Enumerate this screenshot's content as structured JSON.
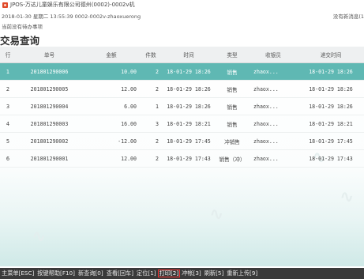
{
  "window": {
    "title": "JPOS-万达儿童娱乐有限公司德州(0002)-0002v机"
  },
  "info": {
    "status_line": "2018-01-30 星期二 13:55:39 0002-0002v-zhaoxuerong",
    "right_text": "没有新消息(1",
    "todo": "当前没有待办事项"
  },
  "page": {
    "title": "交易查询"
  },
  "table": {
    "headers": [
      "行",
      "单号",
      "金额",
      "件数",
      "时间",
      "类型",
      "收银员",
      "递交时间"
    ],
    "rows": [
      {
        "row": "1",
        "no": "201801290006",
        "amount": "10.00",
        "qty": "2",
        "time": "18-01-29 18:26",
        "type": "销售",
        "cashier": "zhaox...",
        "submit": "18-01-29 18:26",
        "selected": true
      },
      {
        "row": "2",
        "no": "201801290005",
        "amount": "12.00",
        "qty": "2",
        "time": "18-01-29 18:26",
        "type": "销售",
        "cashier": "zhaox...",
        "submit": "18-01-29 18:26",
        "selected": false
      },
      {
        "row": "3",
        "no": "201801290004",
        "amount": "6.00",
        "qty": "1",
        "time": "18-01-29 18:26",
        "type": "销售",
        "cashier": "zhaox...",
        "submit": "18-01-29 18:26",
        "selected": false
      },
      {
        "row": "4",
        "no": "201801290003",
        "amount": "16.00",
        "qty": "3",
        "time": "18-01-29 18:21",
        "type": "销售",
        "cashier": "zhaox...",
        "submit": "18-01-29 18:21",
        "selected": false
      },
      {
        "row": "5",
        "no": "201801290002",
        "amount": "-12.00",
        "qty": "2",
        "time": "18-01-29 17:45",
        "type": "冲销售",
        "cashier": "zhaox...",
        "submit": "18-01-29 17:45",
        "selected": false
      },
      {
        "row": "6",
        "no": "201801290001",
        "amount": "12.00",
        "qty": "2",
        "time": "18-01-29 17:43",
        "type": "销售（冲）",
        "cashier": "zhaox...",
        "submit": "18-01-29 17:43",
        "selected": false
      }
    ]
  },
  "shortcuts": [
    {
      "label": "主菜单[ESC]",
      "highlight": false
    },
    {
      "label": "按键帮助[F10]",
      "highlight": false
    },
    {
      "label": "新查询[0]",
      "highlight": false
    },
    {
      "label": "查看[回车]",
      "highlight": false
    },
    {
      "label": "定位[1]",
      "highlight": false
    },
    {
      "label": "打印[2]",
      "highlight": true
    },
    {
      "label": "冲帐[3]",
      "highlight": false
    },
    {
      "label": "刷新[5]",
      "highlight": false
    },
    {
      "label": "重新上传[9]",
      "highlight": false
    }
  ],
  "colors": {
    "selected_row": "#5fb8b3",
    "shortcut_bar": "#3a3a3a",
    "highlight_outline": "#e33333",
    "app_icon": "#e04a2a"
  },
  "icons": {
    "app": "app-logo-icon"
  }
}
